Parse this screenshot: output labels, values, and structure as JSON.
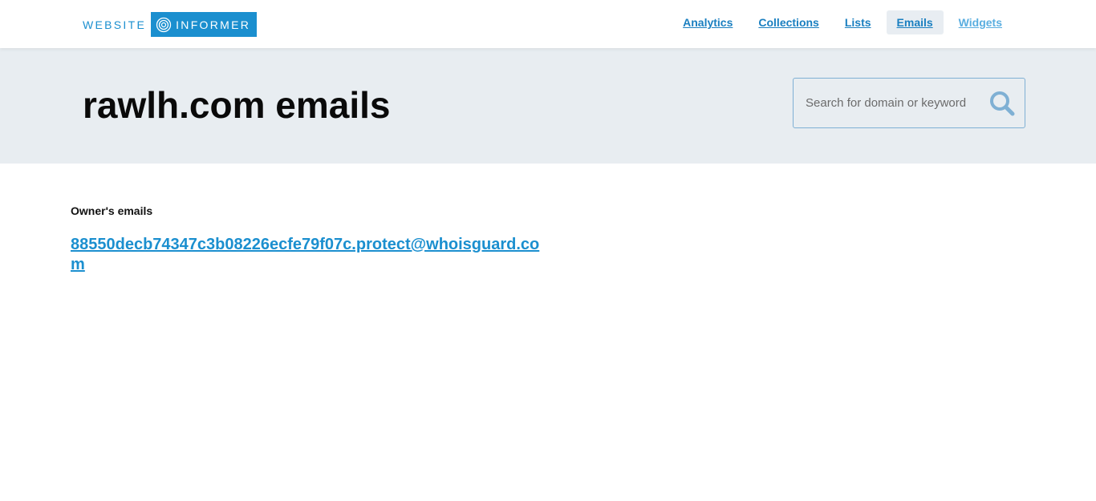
{
  "header": {
    "logo_left": "WEBSITE",
    "logo_right": "INFORMER",
    "nav": [
      {
        "label": "Analytics"
      },
      {
        "label": "Collections"
      },
      {
        "label": "Lists"
      },
      {
        "label": "Emails"
      },
      {
        "label": "Widgets"
      }
    ]
  },
  "hero": {
    "title": "rawlh.com emails",
    "search_placeholder": "Search for domain or keyword"
  },
  "main": {
    "section_label": "Owner's emails",
    "email": "88550decb74347c3b08226ecfe79f07c.protect@whoisguard.com"
  },
  "colors": {
    "brand": "#1b8fcf",
    "hero_bg": "#e8edf1"
  }
}
